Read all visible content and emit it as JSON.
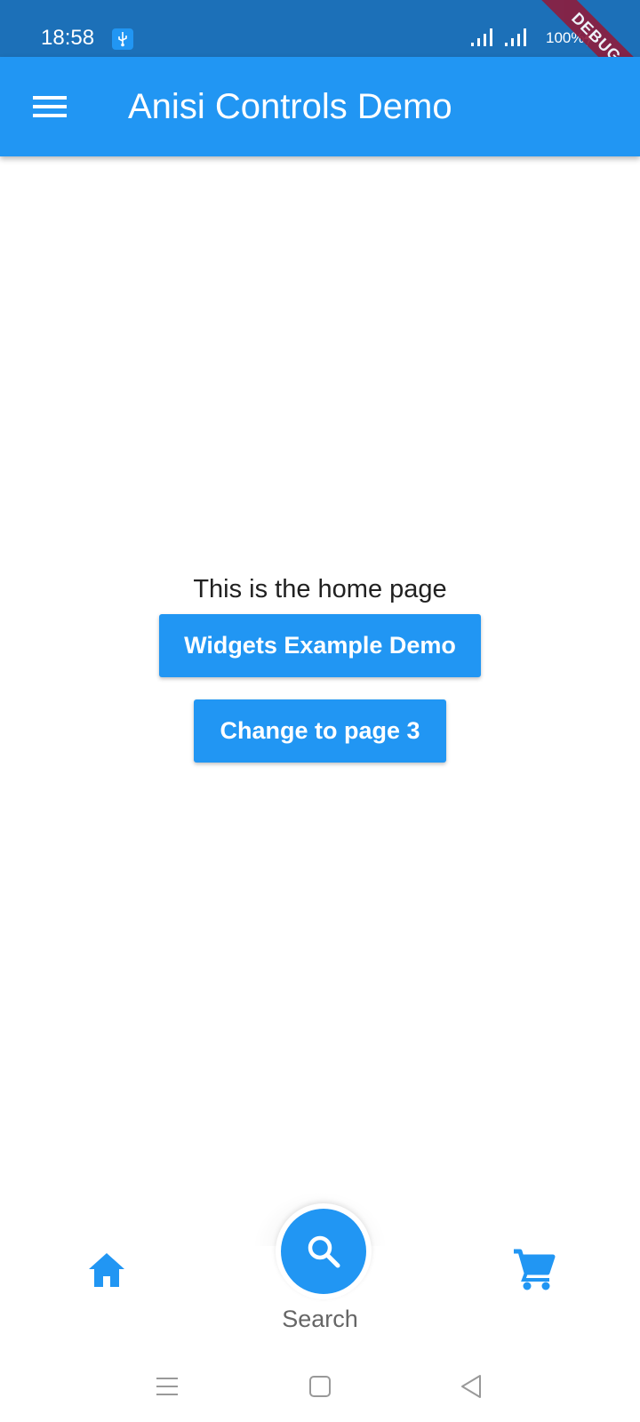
{
  "status_bar": {
    "time": "18:58",
    "battery": "100%",
    "usb_icon": "usb-icon",
    "signal_icon": "signal-icon",
    "battery_icon": "battery-charging-icon"
  },
  "debug_banner": {
    "label": "DEBUG",
    "color": "#8b1e3f"
  },
  "app_bar": {
    "title": "Anisi Controls Demo",
    "menu_icon": "menu-icon",
    "color": "#2196f3"
  },
  "main": {
    "home_text": "This is the home page",
    "buttons": [
      {
        "label": "Widgets Example Demo"
      },
      {
        "label": "Change to page 3"
      }
    ]
  },
  "bottom_nav": {
    "items": [
      {
        "icon": "home-icon"
      },
      {
        "icon": "search-icon",
        "label": "Search",
        "selected": true
      },
      {
        "icon": "cart-icon"
      }
    ],
    "accent": "#2196f3"
  },
  "system_nav": {
    "buttons": [
      "recents-icon",
      "home-square-icon",
      "back-icon"
    ]
  }
}
